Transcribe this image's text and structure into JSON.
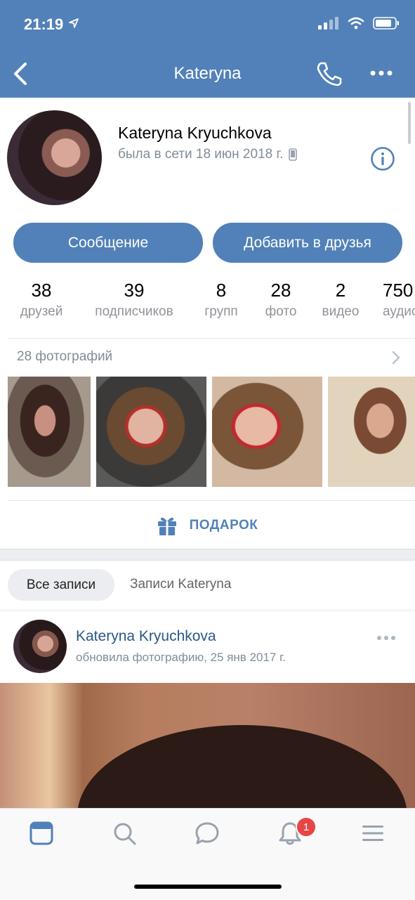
{
  "status_bar": {
    "time": "21:19"
  },
  "nav": {
    "title": "Kateryna"
  },
  "profile": {
    "name": "Kateryna Kryuchkova",
    "last_seen": "была в сети 18 июн 2018 г."
  },
  "actions": {
    "message": "Сообщение",
    "add_friend": "Добавить в друзья"
  },
  "stats": [
    {
      "value": "38",
      "label": "друзей"
    },
    {
      "value": "39",
      "label": "подписчиков"
    },
    {
      "value": "8",
      "label": "групп"
    },
    {
      "value": "28",
      "label": "фото"
    },
    {
      "value": "2",
      "label": "видео"
    },
    {
      "value": "750",
      "label": "аудио"
    }
  ],
  "photos": {
    "header": "28 фотографий"
  },
  "gift": {
    "label": "ПОДАРОК"
  },
  "wall_tabs": {
    "all": "Все записи",
    "own": "Записи Kateryna"
  },
  "post": {
    "author": "Kateryna Kryuchkova",
    "meta": "обновила фотографию, 25 янв 2017 г."
  },
  "tabbar": {
    "notifications_badge": "1"
  },
  "colors": {
    "accent": "#5181b8",
    "link": "#2a5885",
    "badge": "#e64646",
    "secondary_text": "#818c99"
  },
  "icons": [
    "location-arrow-icon",
    "signal-icon",
    "wifi-icon",
    "battery-icon",
    "back-icon",
    "phone-icon",
    "more-icon",
    "info-icon",
    "phone-device-icon",
    "chevron-right-icon",
    "gift-icon",
    "news-icon",
    "search-icon",
    "messages-icon",
    "bell-icon",
    "menu-icon"
  ]
}
